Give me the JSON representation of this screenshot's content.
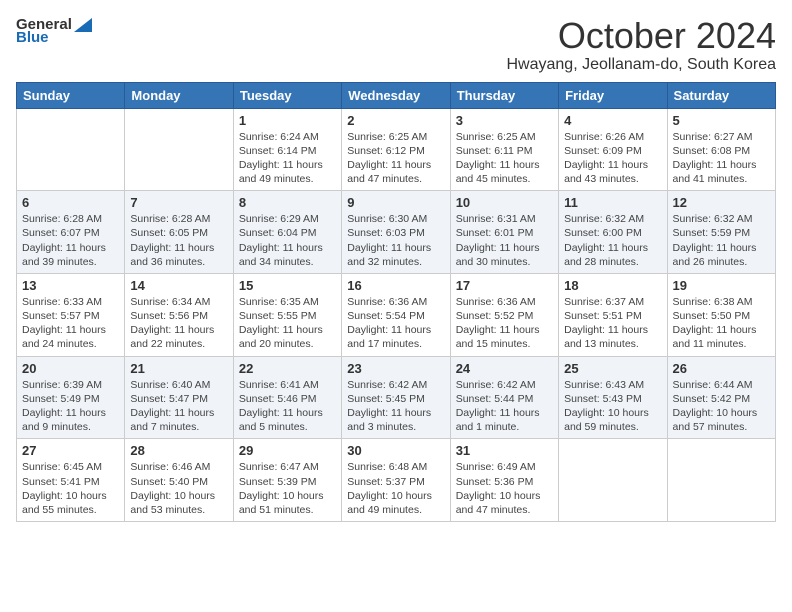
{
  "logo": {
    "text_general": "General",
    "text_blue": "Blue"
  },
  "title": "October 2024",
  "subtitle": "Hwayang, Jeollanam-do, South Korea",
  "days_of_week": [
    "Sunday",
    "Monday",
    "Tuesday",
    "Wednesday",
    "Thursday",
    "Friday",
    "Saturday"
  ],
  "weeks": [
    [
      {
        "day": "",
        "info": ""
      },
      {
        "day": "",
        "info": ""
      },
      {
        "day": "1",
        "info": "Sunrise: 6:24 AM\nSunset: 6:14 PM\nDaylight: 11 hours and 49 minutes."
      },
      {
        "day": "2",
        "info": "Sunrise: 6:25 AM\nSunset: 6:12 PM\nDaylight: 11 hours and 47 minutes."
      },
      {
        "day": "3",
        "info": "Sunrise: 6:25 AM\nSunset: 6:11 PM\nDaylight: 11 hours and 45 minutes."
      },
      {
        "day": "4",
        "info": "Sunrise: 6:26 AM\nSunset: 6:09 PM\nDaylight: 11 hours and 43 minutes."
      },
      {
        "day": "5",
        "info": "Sunrise: 6:27 AM\nSunset: 6:08 PM\nDaylight: 11 hours and 41 minutes."
      }
    ],
    [
      {
        "day": "6",
        "info": "Sunrise: 6:28 AM\nSunset: 6:07 PM\nDaylight: 11 hours and 39 minutes."
      },
      {
        "day": "7",
        "info": "Sunrise: 6:28 AM\nSunset: 6:05 PM\nDaylight: 11 hours and 36 minutes."
      },
      {
        "day": "8",
        "info": "Sunrise: 6:29 AM\nSunset: 6:04 PM\nDaylight: 11 hours and 34 minutes."
      },
      {
        "day": "9",
        "info": "Sunrise: 6:30 AM\nSunset: 6:03 PM\nDaylight: 11 hours and 32 minutes."
      },
      {
        "day": "10",
        "info": "Sunrise: 6:31 AM\nSunset: 6:01 PM\nDaylight: 11 hours and 30 minutes."
      },
      {
        "day": "11",
        "info": "Sunrise: 6:32 AM\nSunset: 6:00 PM\nDaylight: 11 hours and 28 minutes."
      },
      {
        "day": "12",
        "info": "Sunrise: 6:32 AM\nSunset: 5:59 PM\nDaylight: 11 hours and 26 minutes."
      }
    ],
    [
      {
        "day": "13",
        "info": "Sunrise: 6:33 AM\nSunset: 5:57 PM\nDaylight: 11 hours and 24 minutes."
      },
      {
        "day": "14",
        "info": "Sunrise: 6:34 AM\nSunset: 5:56 PM\nDaylight: 11 hours and 22 minutes."
      },
      {
        "day": "15",
        "info": "Sunrise: 6:35 AM\nSunset: 5:55 PM\nDaylight: 11 hours and 20 minutes."
      },
      {
        "day": "16",
        "info": "Sunrise: 6:36 AM\nSunset: 5:54 PM\nDaylight: 11 hours and 17 minutes."
      },
      {
        "day": "17",
        "info": "Sunrise: 6:36 AM\nSunset: 5:52 PM\nDaylight: 11 hours and 15 minutes."
      },
      {
        "day": "18",
        "info": "Sunrise: 6:37 AM\nSunset: 5:51 PM\nDaylight: 11 hours and 13 minutes."
      },
      {
        "day": "19",
        "info": "Sunrise: 6:38 AM\nSunset: 5:50 PM\nDaylight: 11 hours and 11 minutes."
      }
    ],
    [
      {
        "day": "20",
        "info": "Sunrise: 6:39 AM\nSunset: 5:49 PM\nDaylight: 11 hours and 9 minutes."
      },
      {
        "day": "21",
        "info": "Sunrise: 6:40 AM\nSunset: 5:47 PM\nDaylight: 11 hours and 7 minutes."
      },
      {
        "day": "22",
        "info": "Sunrise: 6:41 AM\nSunset: 5:46 PM\nDaylight: 11 hours and 5 minutes."
      },
      {
        "day": "23",
        "info": "Sunrise: 6:42 AM\nSunset: 5:45 PM\nDaylight: 11 hours and 3 minutes."
      },
      {
        "day": "24",
        "info": "Sunrise: 6:42 AM\nSunset: 5:44 PM\nDaylight: 11 hours and 1 minute."
      },
      {
        "day": "25",
        "info": "Sunrise: 6:43 AM\nSunset: 5:43 PM\nDaylight: 10 hours and 59 minutes."
      },
      {
        "day": "26",
        "info": "Sunrise: 6:44 AM\nSunset: 5:42 PM\nDaylight: 10 hours and 57 minutes."
      }
    ],
    [
      {
        "day": "27",
        "info": "Sunrise: 6:45 AM\nSunset: 5:41 PM\nDaylight: 10 hours and 55 minutes."
      },
      {
        "day": "28",
        "info": "Sunrise: 6:46 AM\nSunset: 5:40 PM\nDaylight: 10 hours and 53 minutes."
      },
      {
        "day": "29",
        "info": "Sunrise: 6:47 AM\nSunset: 5:39 PM\nDaylight: 10 hours and 51 minutes."
      },
      {
        "day": "30",
        "info": "Sunrise: 6:48 AM\nSunset: 5:37 PM\nDaylight: 10 hours and 49 minutes."
      },
      {
        "day": "31",
        "info": "Sunrise: 6:49 AM\nSunset: 5:36 PM\nDaylight: 10 hours and 47 minutes."
      },
      {
        "day": "",
        "info": ""
      },
      {
        "day": "",
        "info": ""
      }
    ]
  ]
}
